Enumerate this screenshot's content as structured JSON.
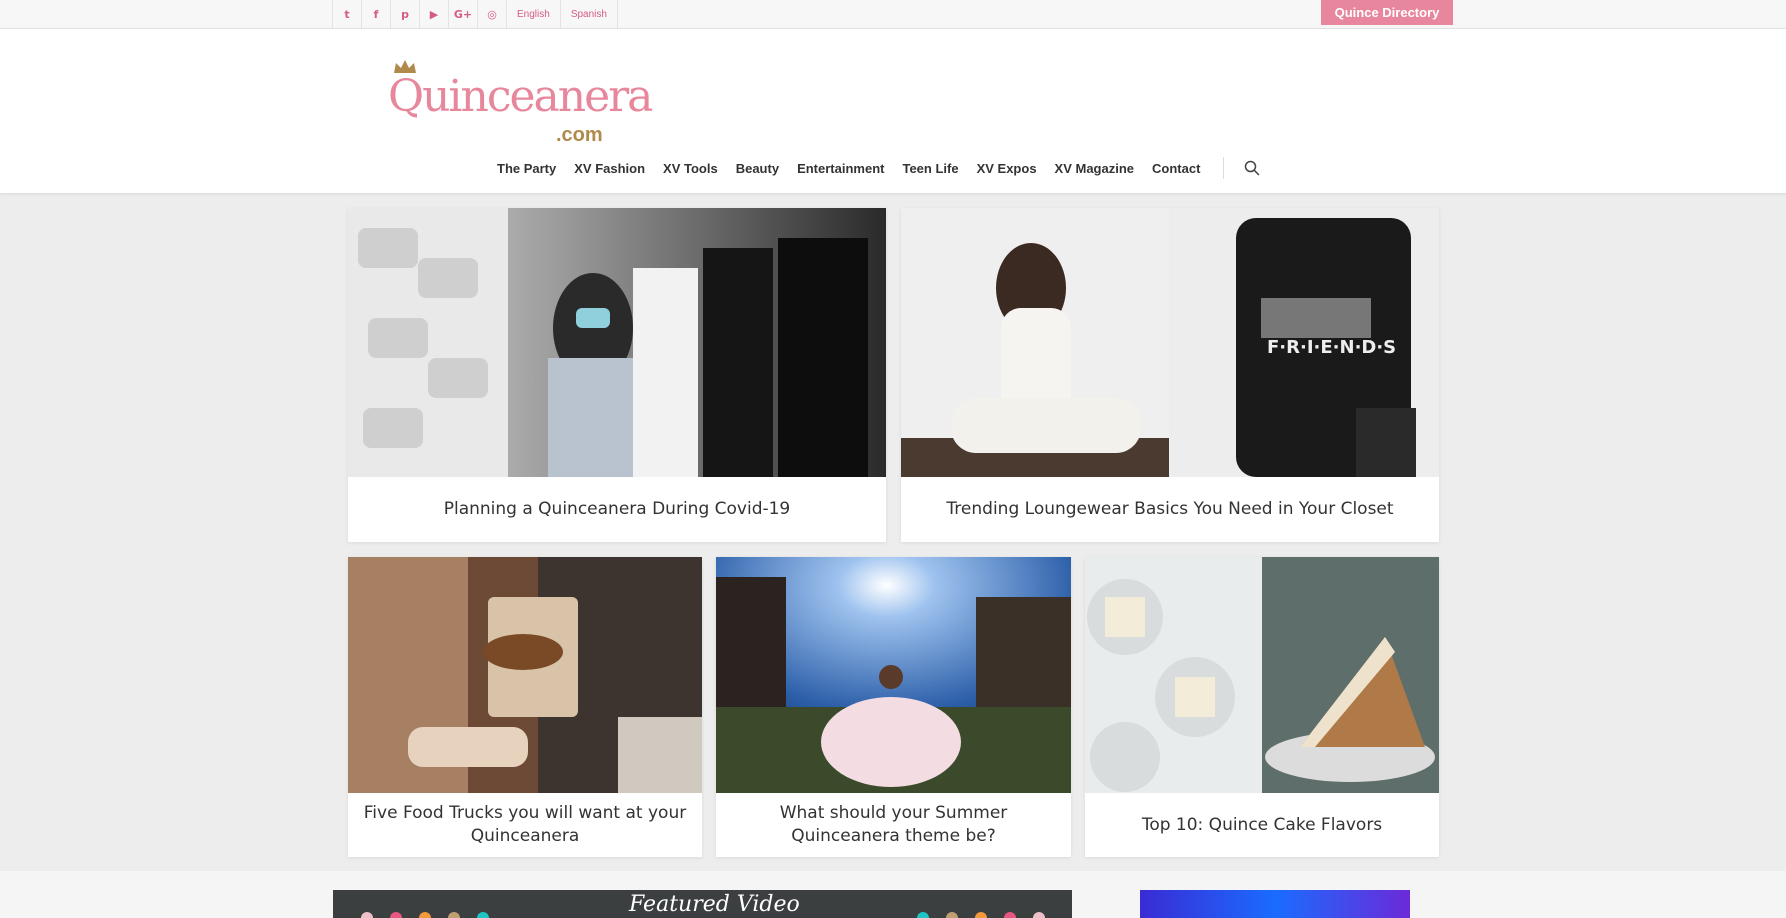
{
  "topbar": {
    "social": [
      "twitter-icon",
      "facebook-icon",
      "pinterest-icon",
      "youtube-icon",
      "google-plus-icon",
      "instagram-icon"
    ],
    "social_glyphs": [
      "t",
      "f",
      "p",
      "▶",
      "G+",
      "◎"
    ],
    "languages": [
      "English",
      "Spanish"
    ],
    "directory_label": "Quince Directory",
    "accent": "#e8869e"
  },
  "header": {
    "logo_text": "Quinceanera",
    "logo_suffix": ".com",
    "nav": [
      "The Party",
      "XV Fashion",
      "XV Tools",
      "Beauty",
      "Entertainment",
      "Teen Life",
      "XV Expos",
      "XV Magazine",
      "Contact"
    ]
  },
  "articles": [
    {
      "title": "Planning a Quinceanera During Covid-19"
    },
    {
      "title": "Trending Loungewear Basics You Need in Your Closet"
    },
    {
      "title": "Five Food Trucks you will want at your Quinceanera"
    },
    {
      "title": "What should your Summer Quinceanera theme be?"
    },
    {
      "title": "Top 10: Quince Cake Flavors"
    }
  ],
  "featured": {
    "title": "Featured Video"
  }
}
